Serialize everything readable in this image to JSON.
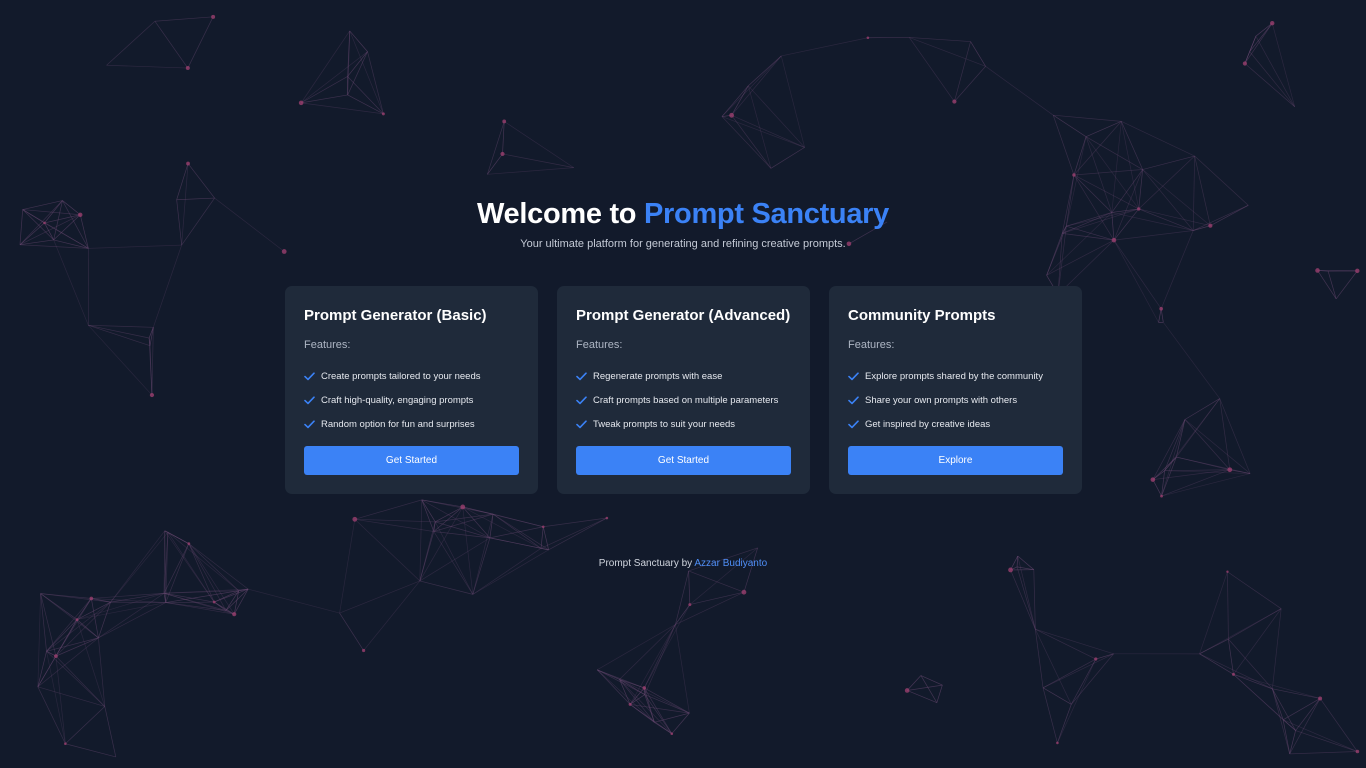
{
  "colors": {
    "background": "#121a2b",
    "card": "#1f2a3a",
    "accent": "#3b82f6",
    "network_line": "#6b4a73",
    "network_node": "#9a3f6e"
  },
  "hero": {
    "title_prefix": "Welcome to",
    "title_accent": "Prompt Sanctuary",
    "subtitle": "Your ultimate platform for generating and refining creative prompts."
  },
  "cards": [
    {
      "title": "Prompt Generator (Basic)",
      "features_label": "Features:",
      "features": [
        "Create prompts tailored to your needs",
        "Craft high-quality, engaging prompts",
        "Random option for fun and surprises"
      ],
      "button": "Get Started"
    },
    {
      "title": "Prompt Generator (Advanced)",
      "features_label": "Features:",
      "features": [
        "Regenerate prompts with ease",
        "Craft prompts based on multiple parameters",
        "Tweak prompts to suit your needs"
      ],
      "button": "Get Started"
    },
    {
      "title": "Community Prompts",
      "features_label": "Features:",
      "features": [
        "Explore prompts shared by the community",
        "Share your own prompts with others",
        "Get inspired by creative ideas"
      ],
      "button": "Explore"
    }
  ],
  "footer": {
    "text": "Prompt Sanctuary by",
    "author": "Azzar Budiyanto"
  },
  "icons": {
    "check": "check-icon"
  }
}
